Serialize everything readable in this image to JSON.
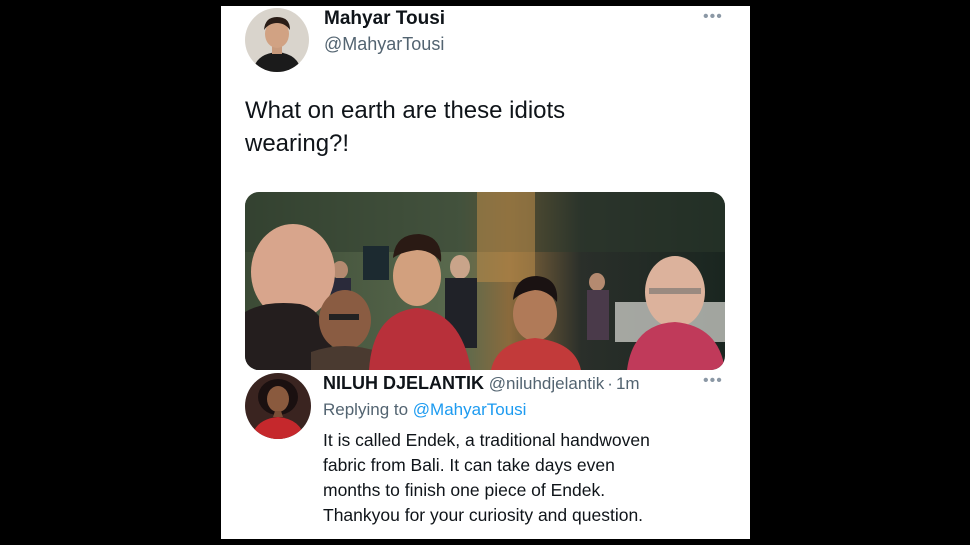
{
  "tweet": {
    "author_name": "Mahyar Tousi",
    "author_handle": "@MahyarTousi",
    "more_icon": "more-horizontal-icon",
    "text": "What on earth are these idiots\nwearing?!"
  },
  "reply": {
    "author_name": "NILUH DJELANTIK",
    "author_handle": "@niluhdjelantik",
    "separator": "·",
    "time": "1m",
    "more_icon": "more-horizontal-icon",
    "replying_prefix": "Replying to",
    "replying_to": "@MahyarTousi",
    "text": "It is called Endek, a traditional handwoven\nfabric from Bali. It can take days even\nmonths to finish one piece of Endek.\nThankyou for your curiosity and question."
  },
  "colors": {
    "link": "#1d9bf0",
    "text": "#0f1419",
    "secondary": "#536471",
    "background": "#000000"
  }
}
